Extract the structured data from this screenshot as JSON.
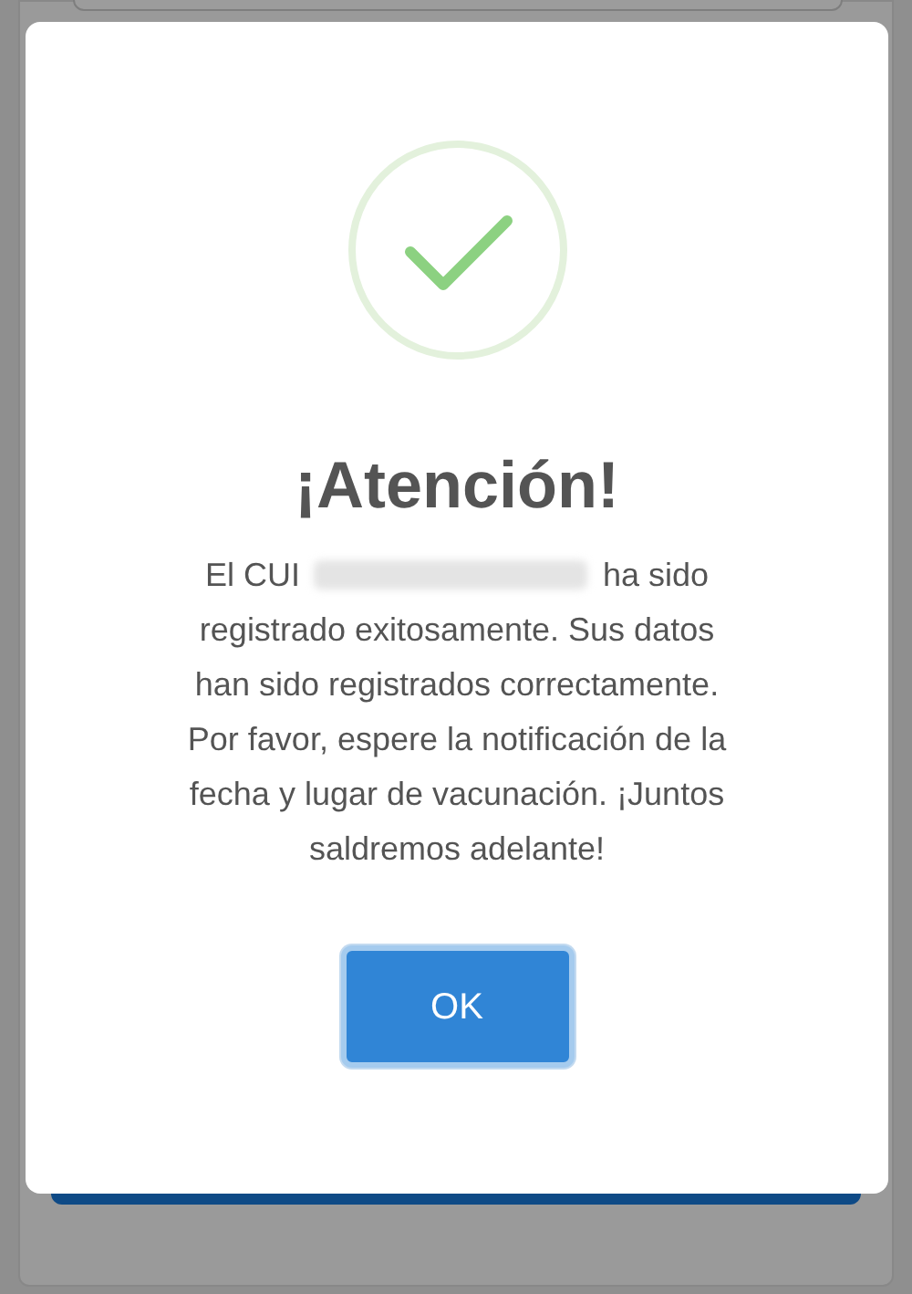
{
  "dialog": {
    "title": "¡Atención!",
    "message_start": "El CUI",
    "message_redacted": true,
    "message_after": "ha sido",
    "message_rest": "registrado exitosamente. Sus datos han sido registrados correctamente. Por favor, espere la notificación de la fecha y lugar de vacunación. ¡Juntos saldremos adelante!",
    "button": "OK"
  }
}
